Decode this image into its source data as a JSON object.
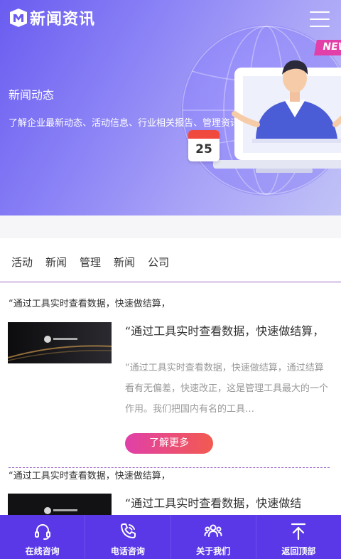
{
  "header": {
    "logo_text": "新闻资讯",
    "logo_icon": "m-shield-icon",
    "menu_icon": "hamburger-menu-icon"
  },
  "hero": {
    "title": "新闻动态",
    "description": "了解企业最新动态、活动信息、行业相关报告、管理资讯",
    "calendar_day": "25",
    "badge": "NEW"
  },
  "tabs": [
    "活动",
    "新闻",
    "管理",
    "新闻",
    "公司"
  ],
  "news": [
    {
      "headline": "“通过工具实时查看数据，快速做结算，",
      "title": "“通过工具实时查看数据，快速做结算，",
      "body": "“通过工具实时查看数据，快速做结算，通过结算看有无偏差，快速改正，这是管理工具最大的一个作用。我们把国内有名的工具…",
      "more_label": "了解更多"
    },
    {
      "headline": "“通过工具实时查看数据，快速做结算，",
      "title": "“通过工具实时查看数据，快速做结"
    }
  ],
  "bottom_nav": [
    {
      "label": "在线咨询",
      "icon": "headset-icon"
    },
    {
      "label": "电话咨询",
      "icon": "phone-icon"
    },
    {
      "label": "关于我们",
      "icon": "people-icon"
    },
    {
      "label": "返回顶部",
      "icon": "arrow-up-icon"
    }
  ],
  "colors": {
    "nav_bg": "#5a38e8",
    "accent_rule": "#9b67c4",
    "button_gradient_start": "#e040a9",
    "button_gradient_end": "#f25a4f"
  }
}
